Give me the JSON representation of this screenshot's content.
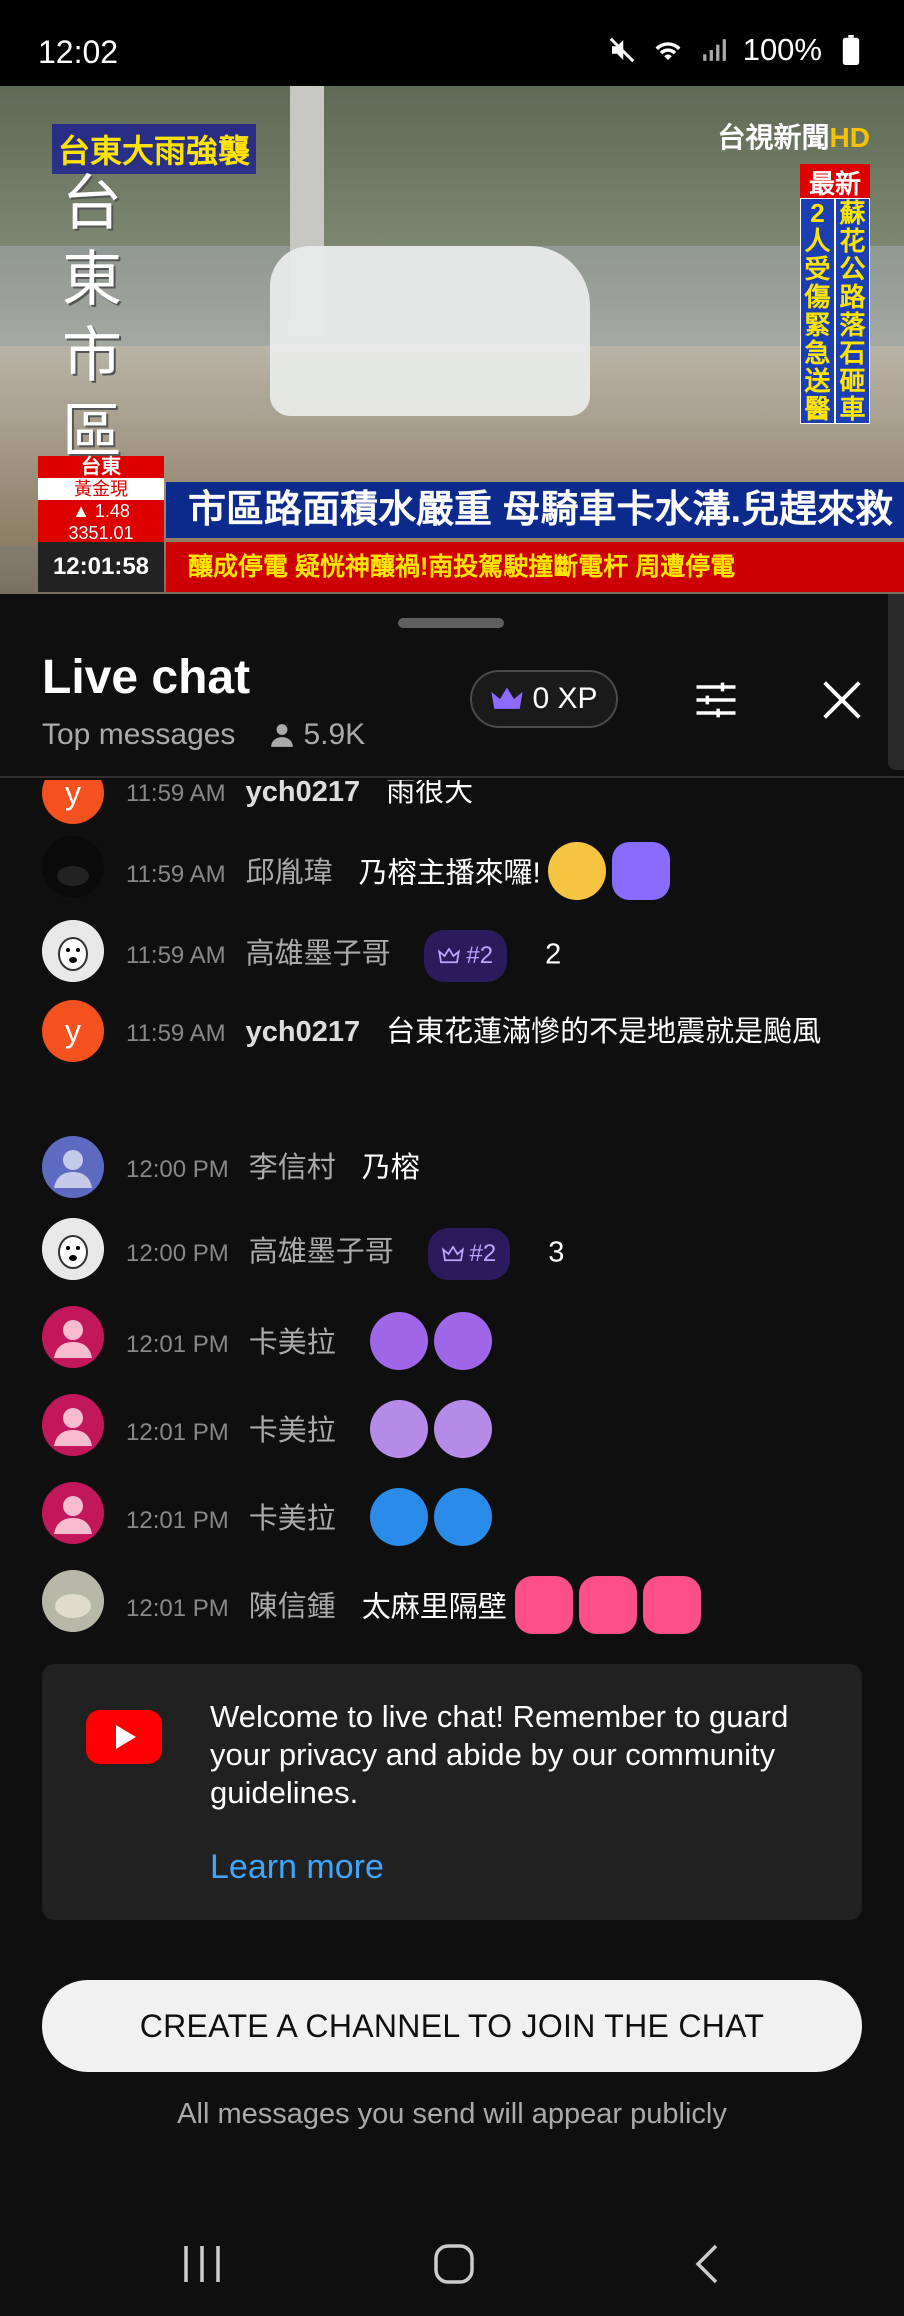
{
  "status_bar": {
    "time": "12:02",
    "battery": "100%"
  },
  "video": {
    "top_left_caption": "台東大雨強襲",
    "vertical_caption": "台東市區",
    "channel_logo": "台視新聞",
    "channel_logo_hd": "HD",
    "news_tag": "最新",
    "side_col_1": "2人受傷緊急送醫",
    "side_col_2": "蘇花公路落石砸車",
    "ticker_region": "台東",
    "ticker_label": "黃金現",
    "ticker_change": "▲ 1.48",
    "ticker_value": "3351.01",
    "headline": "市區路面積水嚴重 母騎車卡水溝.兒趕來救援",
    "clock": "12:01:58",
    "crawl": "釀成停電   疑恍神釀禍!南投駕駛撞斷電杆 周遭停電"
  },
  "chat_header": {
    "title": "Live chat",
    "mode": "Top messages",
    "viewers": "5.9K",
    "xp": "0 XP"
  },
  "messages": [
    {
      "time": "11:59 AM",
      "author": "ych0217",
      "text": "雨很大",
      "avatar_letter": "y"
    },
    {
      "time": "11:59 AM",
      "author": "邱胤瑋",
      "text": "乃榕主播來囉!"
    },
    {
      "time": "11:59 AM",
      "author": "高雄墨子哥",
      "badge": "#2",
      "text": "2"
    },
    {
      "time": "11:59 AM",
      "author": "ych0217",
      "text": "台東花蓮滿慘的不是地震就是颱風",
      "avatar_letter": "y"
    },
    {
      "time": "12:00 PM",
      "author": "李信村",
      "text": "乃榕"
    },
    {
      "time": "12:00 PM",
      "author": "高雄墨子哥",
      "badge": "#2",
      "text": "3"
    },
    {
      "time": "12:01 PM",
      "author": "卡美拉",
      "text": ""
    },
    {
      "time": "12:01 PM",
      "author": "卡美拉",
      "text": ""
    },
    {
      "time": "12:01 PM",
      "author": "卡美拉",
      "text": ""
    },
    {
      "time": "12:01 PM",
      "author": "陳信鍾",
      "text": "太麻里隔壁"
    }
  ],
  "welcome": {
    "text": "Welcome to live chat! Remember to guard your privacy and abide by our community guidelines.",
    "link": "Learn more"
  },
  "create_button": "CREATE A CHANNEL TO JOIN THE CHAT",
  "notice": "All messages you send will appear publicly",
  "colors": {
    "accent_link": "#3ea6ff",
    "badge_bg": "#2b1a5c",
    "youtube_red": "#ff0000",
    "avatar_orange": "#f4511e",
    "avatar_pink": "#c2185b",
    "avatar_blue": "#5c6bc0"
  }
}
